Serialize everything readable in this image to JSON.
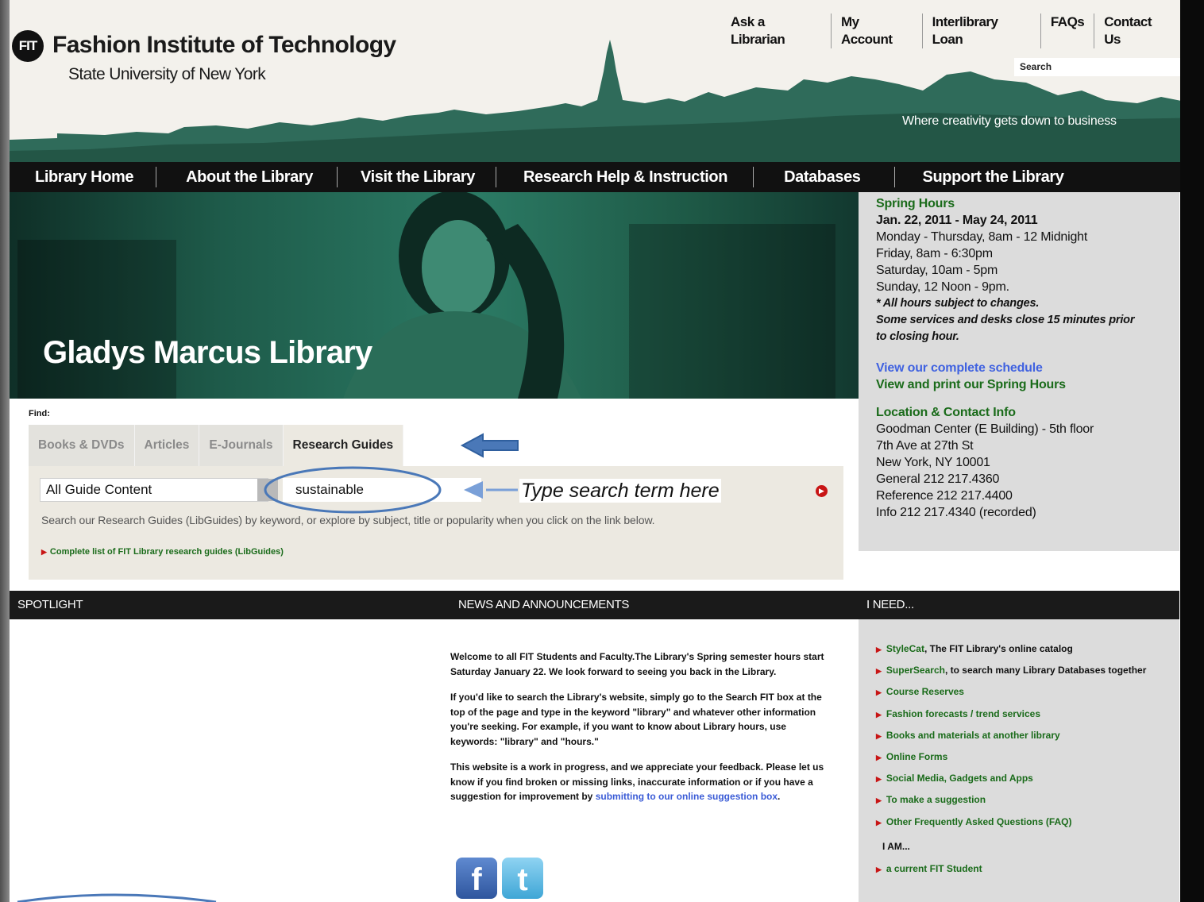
{
  "header": {
    "logo_mark": "FIT",
    "institution": "Fashion Institute of Technology",
    "subtitle": "State University of New York",
    "top_links": [
      "Ask a Librarian",
      "My Account",
      "Interlibrary Loan",
      "FAQs",
      "Contact Us"
    ],
    "search_placeholder": "Search",
    "tagline": "Where creativity gets down to business"
  },
  "nav": {
    "items": [
      "Library Home",
      "About the Library",
      "Visit the Library",
      "Research Help & Instruction",
      "Databases",
      "Support the Library"
    ]
  },
  "hero": {
    "title": "Gladys Marcus Library"
  },
  "hours": {
    "heading": "Spring Hours",
    "dates": "Jan. 22, 2011 - May 24, 2011",
    "lines": [
      "Monday - Thursday, 8am - 12 Midnight",
      "Friday, 8am - 6:30pm",
      "Saturday, 10am - 5pm",
      "Sunday, 12 Noon - 9pm."
    ],
    "note1": "* All hours subject to changes.",
    "note2": "Some services and desks close 15 minutes prior to closing hour.",
    "link1": "View our complete schedule",
    "link2": "View and print our Spring Hours",
    "location_heading": "Location & Contact Info",
    "location_lines": [
      "Goodman Center (E Building) - 5th floor",
      "7th Ave at 27th St",
      "New York, NY 10001",
      "General 212 217.4360",
      "Reference 212 217.4400",
      "Info 212 217.4340 (recorded)"
    ]
  },
  "find": {
    "label": "Find:",
    "tabs": [
      "Books & DVDs",
      "Articles",
      "E-Journals",
      "Research Guides"
    ],
    "active_tab": "Research Guides",
    "select_value": "All Guide Content",
    "input_value": "sustainable",
    "annotation": "Type search term here",
    "description": "Search our Research Guides (LibGuides) by keyword, or explore by subject, title or popularity when you click on the link below.",
    "link": "Complete list of FIT Library research guides (LibGuides)"
  },
  "sections": {
    "spotlight": "SPOTLIGHT",
    "news": "NEWS AND ANNOUNCEMENTS",
    "ineed": "I NEED..."
  },
  "news": {
    "p1": "Welcome to all FIT Students and Faculty.The Library's Spring semester hours start Saturday January 22. We look forward to seeing you back in the Library.",
    "p2": "If you'd like to search the Library's website, simply go to the Search FIT box at the top of the page and type in the keyword \"library\" and whatever other information you're seeking. For example, if you want to know about Library hours, use keywords: \"library\" and \"hours.\"",
    "p3_text": "This website is a work in progress, and we appreciate your feedback. Please let us know if you find broken or missing links, inaccurate information or if you have a suggestion for improvement by ",
    "p3_link": "submitting to our online suggestion box",
    "p3_end": "."
  },
  "ineed": {
    "stylecat": "StyleCat",
    "stylecat_rest": ", The FIT Library's online catalog",
    "supersearch": "SuperSearch",
    "supersearch_rest": ", to search many Library Databases together",
    "items": [
      "Course Reserves",
      "Fashion forecasts / trend services",
      "Books and materials at another library",
      "Online Forms",
      "Social Media, Gadgets and Apps",
      "To make a suggestion",
      "Other Frequently Asked Questions (FAQ)"
    ],
    "iam_label": "I AM...",
    "iam_items": [
      "a current FIT Student"
    ]
  },
  "colors": {
    "brand_green": "#1a6b1a",
    "skyline": "#2f6b5a",
    "accent_red": "#c81515",
    "annotation_blue": "#4a78b8"
  },
  "icons": [
    "search-go-icon",
    "facebook-icon",
    "twitter-icon",
    "arrow-annotation-icon"
  ]
}
